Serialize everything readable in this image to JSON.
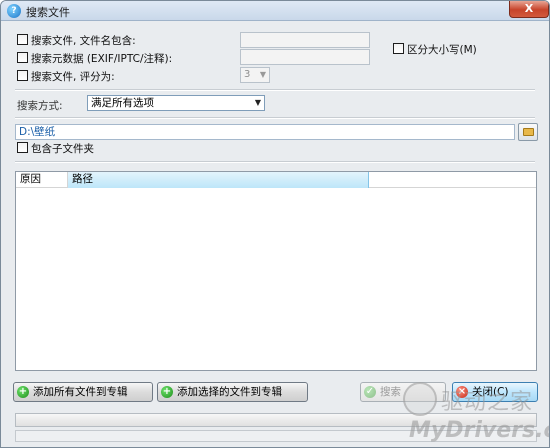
{
  "window": {
    "title": "搜索文件",
    "close_label": "X"
  },
  "options": {
    "filename_contains": "搜索文件, 文件名包含:",
    "metadata": "搜索元数据 (EXIF/IPTC/注释):",
    "rating": "搜索文件, 评分为:",
    "rating_value": "3",
    "case_sensitive": "区分大小写(M)"
  },
  "search_mode": {
    "label": "搜索方式:",
    "value": "满足所有选项"
  },
  "folder": {
    "path": "D:\\壁纸",
    "include_subfolders": "包含子文件夹"
  },
  "table": {
    "columns": [
      "原因",
      "路径"
    ]
  },
  "buttons": {
    "add_all": "添加所有文件到专辑",
    "add_selected": "添加选择的文件到专辑",
    "search": "搜索",
    "close": "关闭(C)"
  },
  "watermark": {
    "cn": "驱动之家",
    "en": "MyDrivers.com"
  }
}
